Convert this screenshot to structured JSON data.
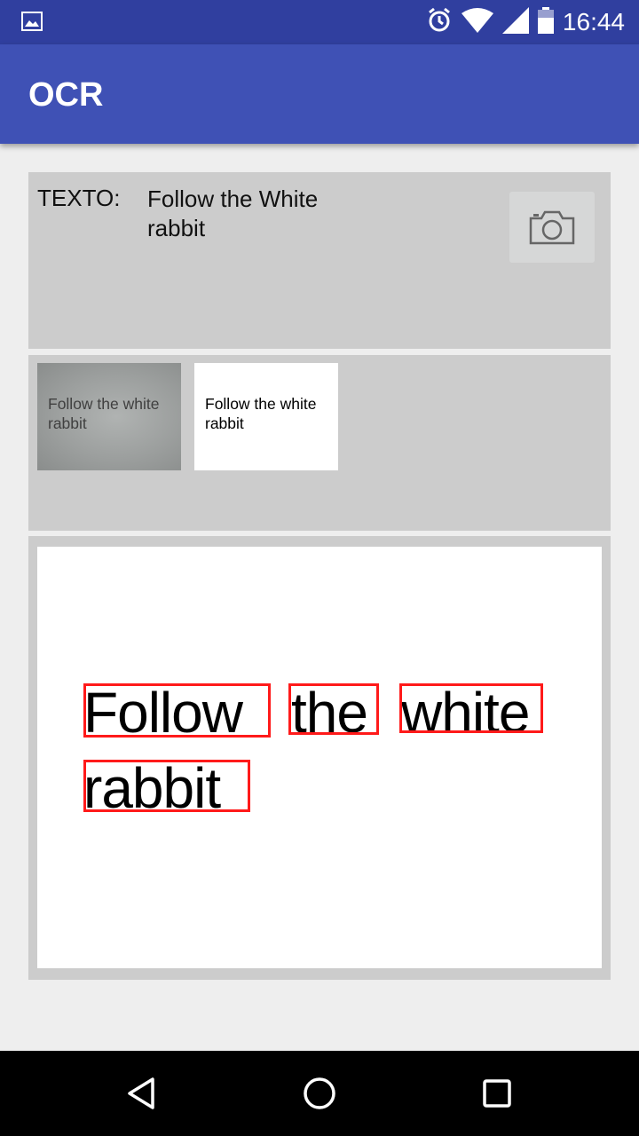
{
  "status_bar": {
    "time": "16:44",
    "icons": [
      "image-notification-icon",
      "alarm-icon",
      "wifi-icon",
      "signal-icon",
      "battery-icon"
    ]
  },
  "app_bar": {
    "title": "OCR"
  },
  "colors": {
    "status_bar": "#303F9F",
    "app_bar": "#3F51B5",
    "panel": "#CCCCCC",
    "background": "#EEEEEE",
    "ocr_box": "#FF1A1A"
  },
  "text_panel": {
    "label": "TEXTO:",
    "value_line1": "Follow the White",
    "value_line2": "rabbit",
    "camera_icon": "camera-icon"
  },
  "thumbnails": [
    {
      "line1": "Follow the white",
      "line2": "rabbit",
      "style": "grayscale-photo"
    },
    {
      "line1": "Follow the white",
      "line2": "rabbit",
      "style": "binarized"
    }
  ],
  "result": {
    "words": [
      "Follow",
      "the",
      "white",
      "rabbit"
    ]
  },
  "nav_bar": {
    "icons": [
      "back-icon",
      "home-icon",
      "recents-icon"
    ]
  }
}
